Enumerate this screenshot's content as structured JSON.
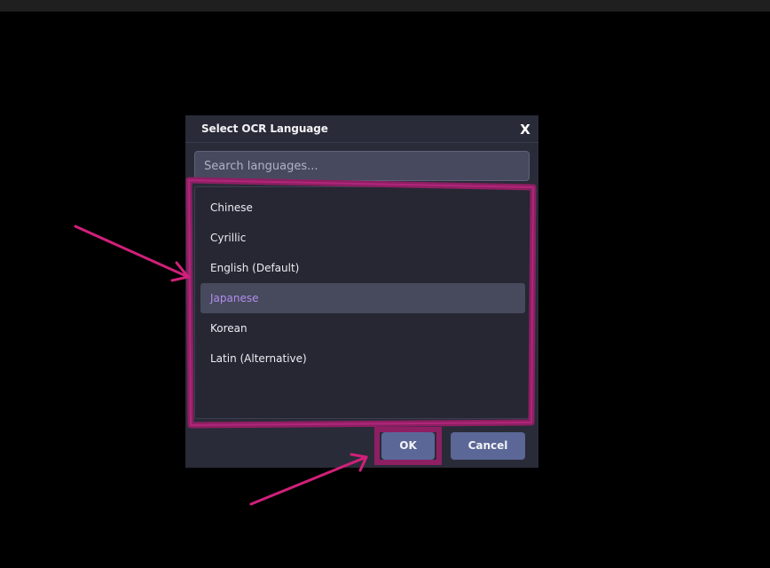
{
  "dialog": {
    "title": "Select OCR Language",
    "close_label": "X",
    "search": {
      "placeholder": "Search languages...",
      "value": ""
    },
    "languages": [
      {
        "label": "Chinese",
        "selected": false
      },
      {
        "label": "Cyrillic",
        "selected": false
      },
      {
        "label": "English (Default)",
        "selected": false
      },
      {
        "label": "Japanese",
        "selected": true
      },
      {
        "label": "Korean",
        "selected": false
      },
      {
        "label": "Latin (Alternative)",
        "selected": false
      }
    ],
    "buttons": {
      "ok_label": "OK",
      "cancel_label": "Cancel"
    }
  },
  "colors": {
    "background": "#000000",
    "dialog_bg": "#2a2b38",
    "list_bg": "#262733",
    "selected_bg": "#464a5c",
    "selected_text": "#b48cf0",
    "button_bg": "#5b6796",
    "annotation": "#d1207a"
  },
  "annotations": {
    "list_highlight": "magenta-box-around-language-list",
    "ok_highlight": "magenta-box-around-ok-button",
    "arrows": [
      "arrow-pointing-to-language-list",
      "arrow-pointing-to-ok-button"
    ]
  }
}
